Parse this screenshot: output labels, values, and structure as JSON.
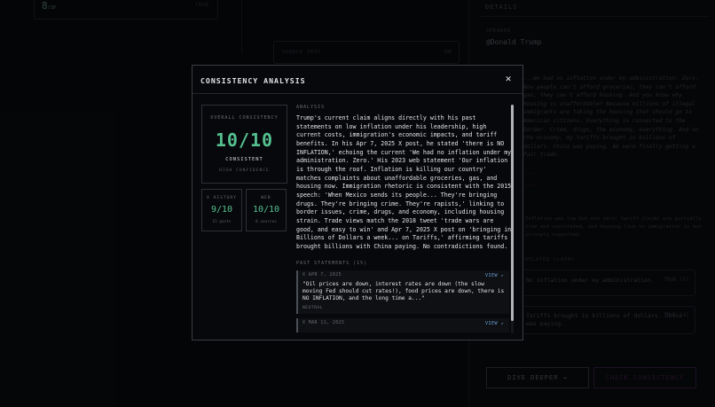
{
  "background": {
    "left_card": {
      "number": "8",
      "unit": "/10",
      "tag": "TRUE"
    },
    "mid_card": {
      "label": "SOURCE TEXT",
      "value": "100"
    },
    "details": {
      "title": "DETAILS",
      "speaker_label": "SPEAKER",
      "speaker": "@Donald Trump",
      "claim": "...We had no inflation under my administration. Zero. Now people can't afford groceries, they can't afford gas, they can't afford housing. And you know why housing is unaffordable? Because millions of illegal immigrants are taking the housing that should go to American citizens. Everything is connected to the border. Crime, drugs, the economy, everything. And on the economy, my tariffs brought in billions of dollars. China was paying. We were finally getting a fair trade.",
      "red_1": "...",
      "red_2": "...",
      "note": "Inflation was low but not zero; tariff claims are partially true and overstated, and housing link to immigration is not strongly supported.",
      "related_label": "RELATED CLAIMS",
      "related": [
        {
          "text": "No inflation under my administration.",
          "meta": "TRUE  (5)"
        },
        {
          "text": "Tariffs brought in billions of dollars. China was paying.",
          "meta": "TRUE  (4)"
        }
      ],
      "btn_deeper": "DIVE DEEPER →",
      "btn_check": "CHECK CONSISTENCY"
    }
  },
  "modal": {
    "title": "CONSISTENCY ANALYSIS",
    "close_glyph": "✕",
    "overall": {
      "label": "OVERALL CONSISTENCY",
      "score": "10/10",
      "verdict": "CONSISTENT",
      "confidence": "HIGH CONFIDENCE"
    },
    "x_history": {
      "label": "X HISTORY",
      "score": "9/10",
      "sub": "15 posts"
    },
    "web": {
      "label": "WEB",
      "score": "10/10",
      "sub": "8 sources"
    },
    "analysis_label": "ANALYSIS",
    "analysis": "Trump's current claim aligns directly with his past statements on low inflation under his leadership, high current costs, immigration's economic impacts, and tariff benefits. In his Apr 7, 2025 X post, he stated 'there is NO INFLATION,' echoing the current 'We had no inflation under my administration. Zero.' His 2023 web statement 'Our inflation is through the roof. Inflation is killing our country' matches complaints about unaffordable groceries, gas, and housing now. Immigration rhetoric is consistent with the 2015 speech: 'When Mexico sends its people... They're bringing drugs. They're bringing crime. They're rapists,' linking to border issues, crime, drugs, and economy, including housing strain. Trade views match the 2018 tweet 'trade wars are good, and easy to win' and Apr 7, 2025 X post on 'bringing in Billions of Dollars a week... on Tariffs,' affirming tariffs brought billions with China paying. No contradictions found.",
    "past_label": "PAST STATEMENTS (15)",
    "statements": [
      {
        "date": "X APR 7, 2025",
        "view": "VIEW ↗",
        "text": "\"Oil prices are down, interest rates are down (the slow moving Fed should cut rates!), food prices are down, there is NO INFLATION, and the long time a...\"",
        "tag": "NEUTRAL"
      },
      {
        "date": "X MAR 11, 2025",
        "view": "VIEW ↗",
        "text": "",
        "tag": ""
      }
    ]
  },
  "colors": {
    "accent_green": "#55c08f",
    "link_blue": "#6ea0d8",
    "modal_bg": "#07080b"
  }
}
